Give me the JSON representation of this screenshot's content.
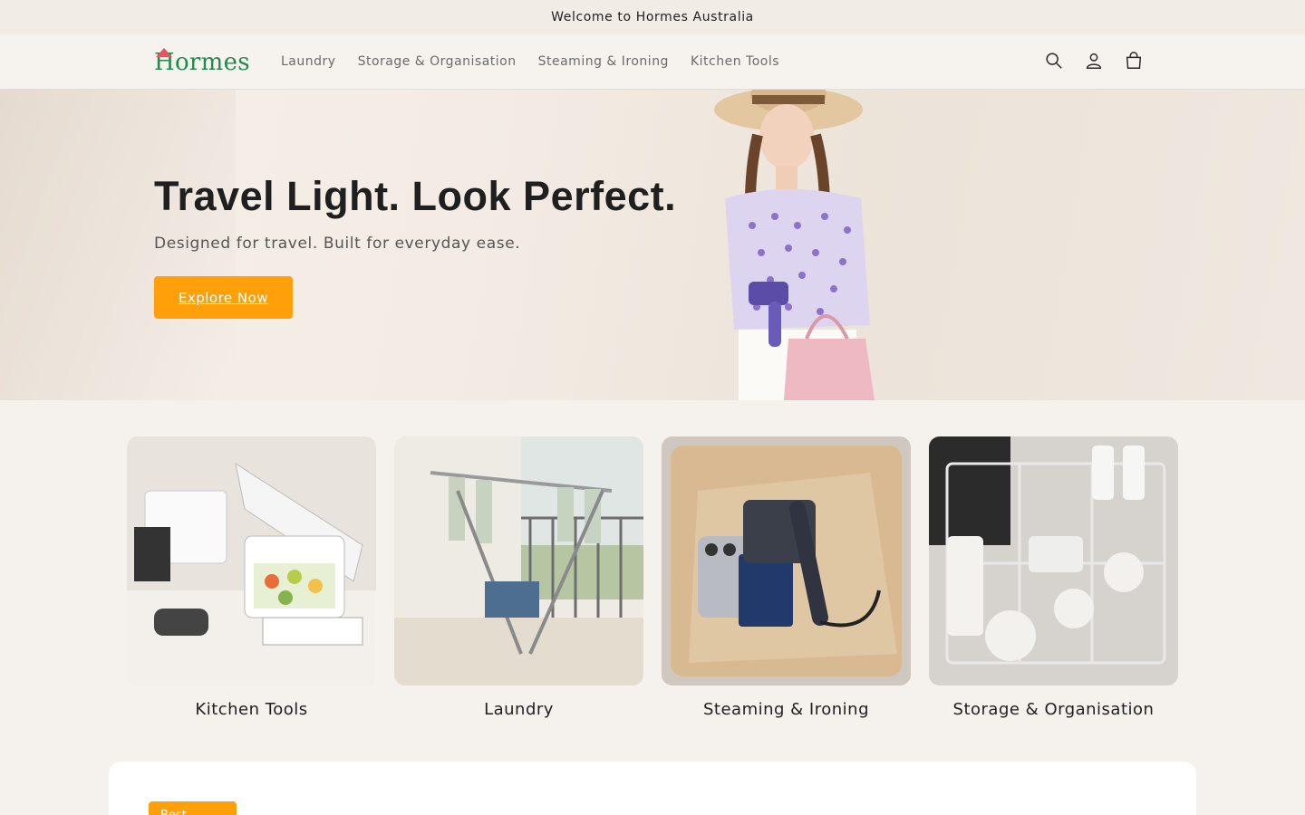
{
  "announcement": "Welcome to Hormes Australia",
  "brand": {
    "name": "Hormes",
    "color": "#1f8a4c",
    "accent": "#e25562"
  },
  "nav": {
    "items": [
      "Laundry",
      "Storage & Organisation",
      "Steaming & Ironing",
      "Kitchen Tools"
    ]
  },
  "header_icons": [
    "search-icon",
    "account-icon",
    "cart-icon"
  ],
  "hero": {
    "title": "Travel Light. Look Perfect.",
    "subtitle": "Designed for travel. Built for everyday ease.",
    "cta": "Explore Now",
    "cta_color": "#ff9f0a"
  },
  "categories": [
    {
      "label": "Kitchen Tools"
    },
    {
      "label": "Laundry"
    },
    {
      "label": "Steaming & Ironing"
    },
    {
      "label": "Storage & Organisation"
    }
  ],
  "best_sellers": {
    "badge": "Best Sellers"
  }
}
